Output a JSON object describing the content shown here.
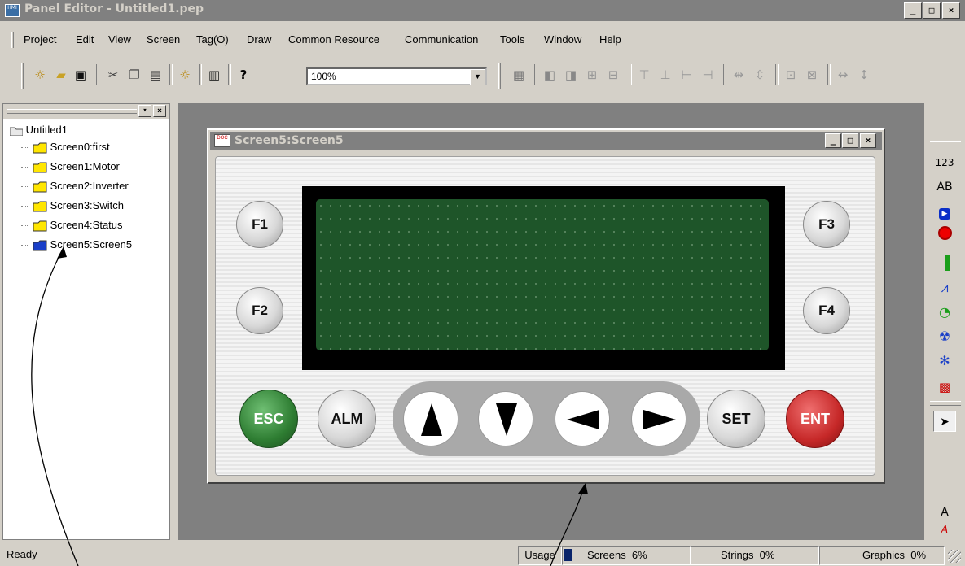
{
  "window": {
    "title": "Panel Editor - Untitled1.pep",
    "icon_label": "HMI"
  },
  "caption_buttons": [
    "_",
    "□",
    "×"
  ],
  "menu": [
    "Project",
    "Edit",
    "View",
    "Screen",
    "Tag(O)",
    "Draw",
    "Common Resource",
    "Communication",
    "Tools",
    "Window",
    "Help"
  ],
  "toolbar": {
    "zoom": "100%",
    "icons": [
      "new-screen-icon",
      "open-folder-icon",
      "save-icon",
      "cut-icon",
      "copy-icon",
      "paste-icon",
      "compile-icon",
      "download-icon",
      "help-icon"
    ]
  },
  "tree": {
    "root": "Untitled1",
    "items": [
      "Screen0:first",
      "Screen1:Motor",
      "Screen2:Inverter",
      "Screen3:Switch",
      "Screen4:Status",
      "Screen5:Screen5"
    ],
    "selected_index": 5
  },
  "child_window": {
    "title": "Screen5:Screen5",
    "icon_label": "DOC"
  },
  "panel": {
    "function_keys": [
      "F1",
      "F2",
      "F3",
      "F4"
    ],
    "keys": {
      "esc": "ESC",
      "alm": "ALM",
      "set": "SET",
      "ent": "ENT"
    },
    "arrows": [
      "up-arrow-icon",
      "down-arrow-icon",
      "left-arrow-icon",
      "right-arrow-icon"
    ]
  },
  "toolbox": {
    "numeric_label": "123",
    "text_label": "AB",
    "select_label": "A",
    "red_label": "A"
  },
  "status": {
    "ready": "Ready",
    "usage_label": "Usage",
    "screens": "Screens  6%",
    "strings": "Strings  0%",
    "graphics": "Graphics  0%",
    "screens_fraction": 0.06
  },
  "colors": {
    "esc_key": "#2e7d32",
    "ent_key": "#c62828",
    "lcd": "#1e5529",
    "title_bar": "#808080"
  }
}
